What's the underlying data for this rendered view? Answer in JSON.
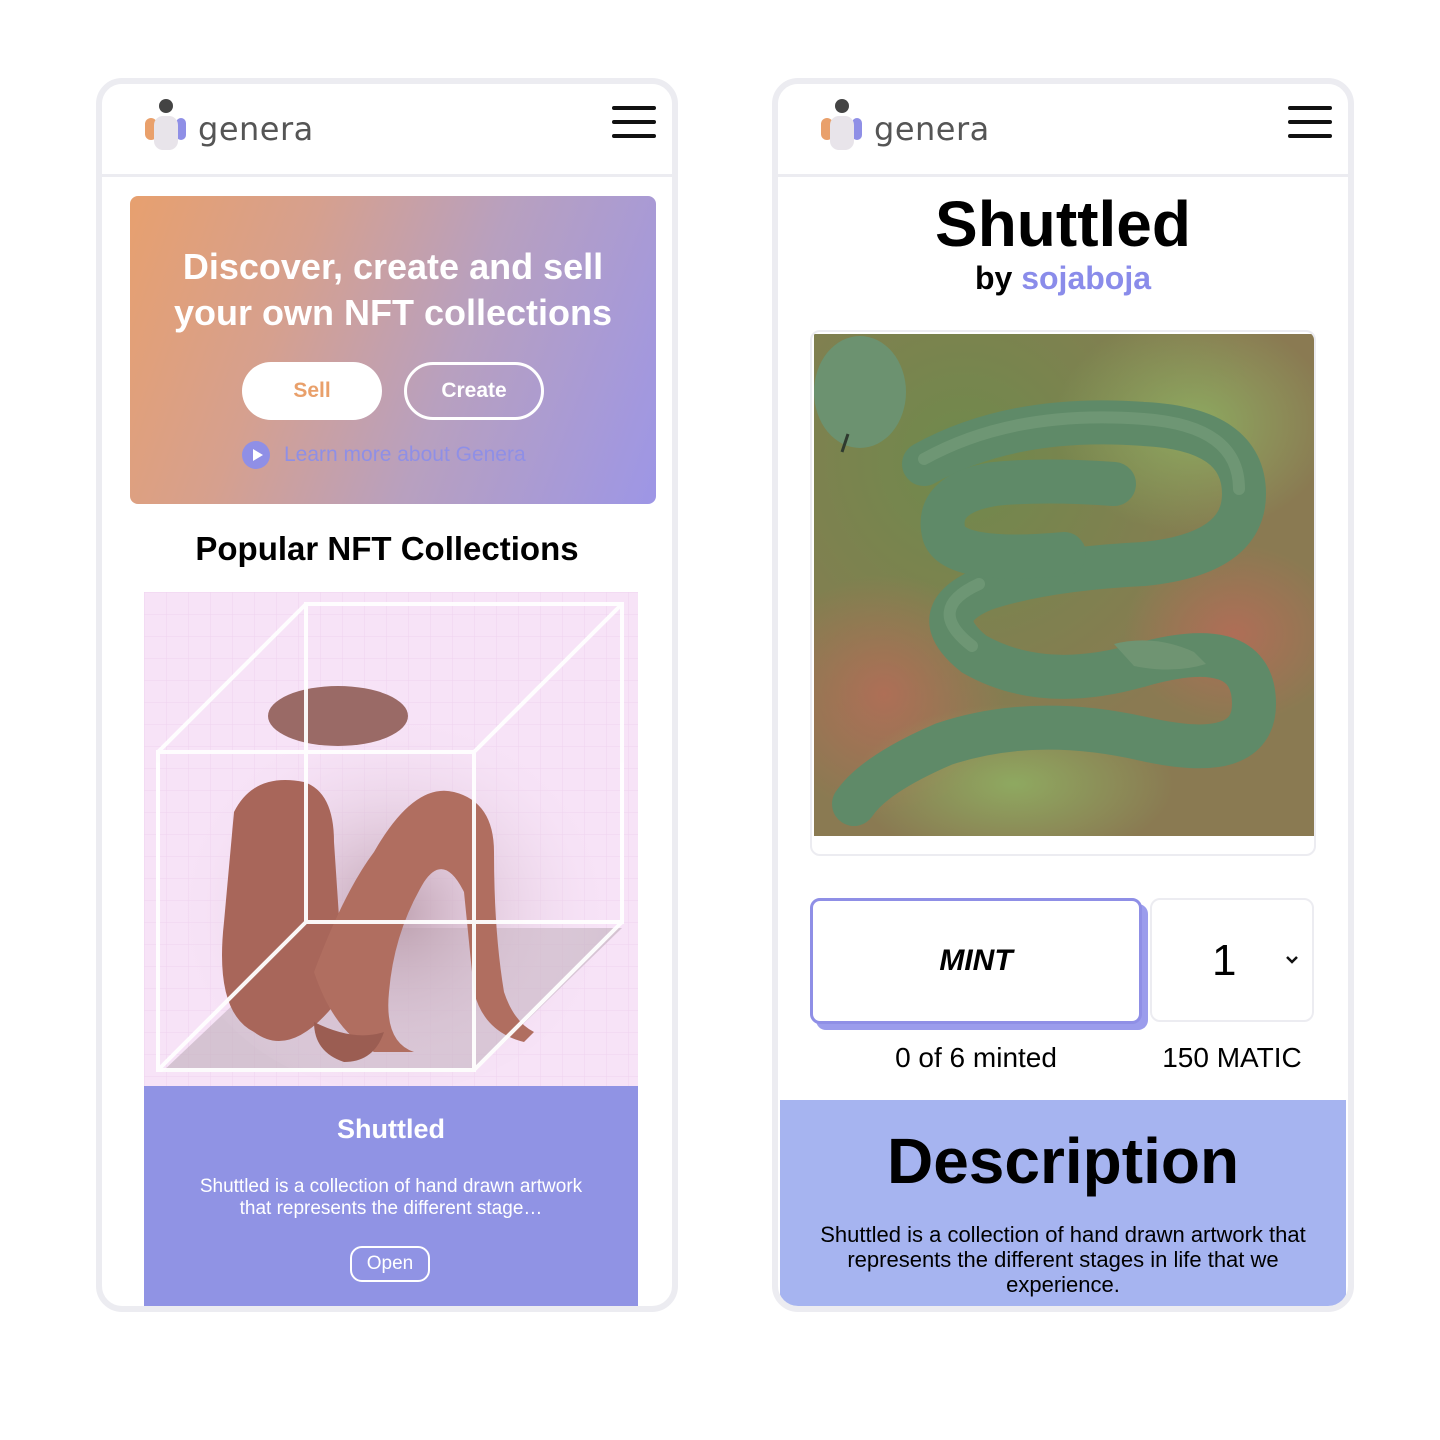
{
  "brand": {
    "logo_text": "genera",
    "colors": {
      "accent": "#8f8fe6",
      "card_bg": "#9093e4",
      "description_bg": "#a6b4f0",
      "sell_text": "#e9a06b",
      "hero_gradient_start": "#e7a06f",
      "hero_gradient_end": "#9d96e6"
    }
  },
  "home": {
    "menu_icon": "hamburger-menu-icon",
    "hero": {
      "title": "Discover, create and sell your own NFT collections",
      "sell_label": "Sell",
      "create_label": "Create",
      "learn_more_label": "Learn more about Genera",
      "learn_more_icon": "play-circle-icon"
    },
    "section_title": "Popular NFT Collections",
    "collection_card": {
      "title": "Shuttled",
      "description": "Shuttled is a collection of hand drawn artwork that represents the different stage…",
      "open_label": "Open"
    }
  },
  "detail": {
    "menu_icon": "hamburger-menu-icon",
    "title": "Shuttled",
    "by_prefix": "by",
    "artist": "sojaboja",
    "mint_label": "MINT",
    "quantity": "1",
    "minted_status": "0 of 6 minted",
    "price": "150 MATIC",
    "description_heading": "Description",
    "description_text": "Shuttled is a collection of hand drawn artwork that represents the different stages in life that we experience."
  }
}
